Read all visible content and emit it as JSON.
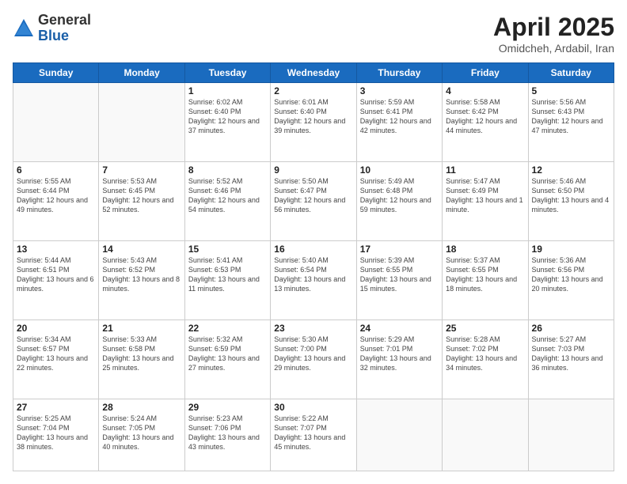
{
  "header": {
    "logo_general": "General",
    "logo_blue": "Blue",
    "month_year": "April 2025",
    "location": "Omidcheh, Ardabil, Iran"
  },
  "weekdays": [
    "Sunday",
    "Monday",
    "Tuesday",
    "Wednesday",
    "Thursday",
    "Friday",
    "Saturday"
  ],
  "weeks": [
    [
      {
        "day": "",
        "sunrise": "",
        "sunset": "",
        "daylight": ""
      },
      {
        "day": "",
        "sunrise": "",
        "sunset": "",
        "daylight": ""
      },
      {
        "day": "1",
        "sunrise": "Sunrise: 6:02 AM",
        "sunset": "Sunset: 6:40 PM",
        "daylight": "Daylight: 12 hours and 37 minutes."
      },
      {
        "day": "2",
        "sunrise": "Sunrise: 6:01 AM",
        "sunset": "Sunset: 6:40 PM",
        "daylight": "Daylight: 12 hours and 39 minutes."
      },
      {
        "day": "3",
        "sunrise": "Sunrise: 5:59 AM",
        "sunset": "Sunset: 6:41 PM",
        "daylight": "Daylight: 12 hours and 42 minutes."
      },
      {
        "day": "4",
        "sunrise": "Sunrise: 5:58 AM",
        "sunset": "Sunset: 6:42 PM",
        "daylight": "Daylight: 12 hours and 44 minutes."
      },
      {
        "day": "5",
        "sunrise": "Sunrise: 5:56 AM",
        "sunset": "Sunset: 6:43 PM",
        "daylight": "Daylight: 12 hours and 47 minutes."
      }
    ],
    [
      {
        "day": "6",
        "sunrise": "Sunrise: 5:55 AM",
        "sunset": "Sunset: 6:44 PM",
        "daylight": "Daylight: 12 hours and 49 minutes."
      },
      {
        "day": "7",
        "sunrise": "Sunrise: 5:53 AM",
        "sunset": "Sunset: 6:45 PM",
        "daylight": "Daylight: 12 hours and 52 minutes."
      },
      {
        "day": "8",
        "sunrise": "Sunrise: 5:52 AM",
        "sunset": "Sunset: 6:46 PM",
        "daylight": "Daylight: 12 hours and 54 minutes."
      },
      {
        "day": "9",
        "sunrise": "Sunrise: 5:50 AM",
        "sunset": "Sunset: 6:47 PM",
        "daylight": "Daylight: 12 hours and 56 minutes."
      },
      {
        "day": "10",
        "sunrise": "Sunrise: 5:49 AM",
        "sunset": "Sunset: 6:48 PM",
        "daylight": "Daylight: 12 hours and 59 minutes."
      },
      {
        "day": "11",
        "sunrise": "Sunrise: 5:47 AM",
        "sunset": "Sunset: 6:49 PM",
        "daylight": "Daylight: 13 hours and 1 minute."
      },
      {
        "day": "12",
        "sunrise": "Sunrise: 5:46 AM",
        "sunset": "Sunset: 6:50 PM",
        "daylight": "Daylight: 13 hours and 4 minutes."
      }
    ],
    [
      {
        "day": "13",
        "sunrise": "Sunrise: 5:44 AM",
        "sunset": "Sunset: 6:51 PM",
        "daylight": "Daylight: 13 hours and 6 minutes."
      },
      {
        "day": "14",
        "sunrise": "Sunrise: 5:43 AM",
        "sunset": "Sunset: 6:52 PM",
        "daylight": "Daylight: 13 hours and 8 minutes."
      },
      {
        "day": "15",
        "sunrise": "Sunrise: 5:41 AM",
        "sunset": "Sunset: 6:53 PM",
        "daylight": "Daylight: 13 hours and 11 minutes."
      },
      {
        "day": "16",
        "sunrise": "Sunrise: 5:40 AM",
        "sunset": "Sunset: 6:54 PM",
        "daylight": "Daylight: 13 hours and 13 minutes."
      },
      {
        "day": "17",
        "sunrise": "Sunrise: 5:39 AM",
        "sunset": "Sunset: 6:55 PM",
        "daylight": "Daylight: 13 hours and 15 minutes."
      },
      {
        "day": "18",
        "sunrise": "Sunrise: 5:37 AM",
        "sunset": "Sunset: 6:55 PM",
        "daylight": "Daylight: 13 hours and 18 minutes."
      },
      {
        "day": "19",
        "sunrise": "Sunrise: 5:36 AM",
        "sunset": "Sunset: 6:56 PM",
        "daylight": "Daylight: 13 hours and 20 minutes."
      }
    ],
    [
      {
        "day": "20",
        "sunrise": "Sunrise: 5:34 AM",
        "sunset": "Sunset: 6:57 PM",
        "daylight": "Daylight: 13 hours and 22 minutes."
      },
      {
        "day": "21",
        "sunrise": "Sunrise: 5:33 AM",
        "sunset": "Sunset: 6:58 PM",
        "daylight": "Daylight: 13 hours and 25 minutes."
      },
      {
        "day": "22",
        "sunrise": "Sunrise: 5:32 AM",
        "sunset": "Sunset: 6:59 PM",
        "daylight": "Daylight: 13 hours and 27 minutes."
      },
      {
        "day": "23",
        "sunrise": "Sunrise: 5:30 AM",
        "sunset": "Sunset: 7:00 PM",
        "daylight": "Daylight: 13 hours and 29 minutes."
      },
      {
        "day": "24",
        "sunrise": "Sunrise: 5:29 AM",
        "sunset": "Sunset: 7:01 PM",
        "daylight": "Daylight: 13 hours and 32 minutes."
      },
      {
        "day": "25",
        "sunrise": "Sunrise: 5:28 AM",
        "sunset": "Sunset: 7:02 PM",
        "daylight": "Daylight: 13 hours and 34 minutes."
      },
      {
        "day": "26",
        "sunrise": "Sunrise: 5:27 AM",
        "sunset": "Sunset: 7:03 PM",
        "daylight": "Daylight: 13 hours and 36 minutes."
      }
    ],
    [
      {
        "day": "27",
        "sunrise": "Sunrise: 5:25 AM",
        "sunset": "Sunset: 7:04 PM",
        "daylight": "Daylight: 13 hours and 38 minutes."
      },
      {
        "day": "28",
        "sunrise": "Sunrise: 5:24 AM",
        "sunset": "Sunset: 7:05 PM",
        "daylight": "Daylight: 13 hours and 40 minutes."
      },
      {
        "day": "29",
        "sunrise": "Sunrise: 5:23 AM",
        "sunset": "Sunset: 7:06 PM",
        "daylight": "Daylight: 13 hours and 43 minutes."
      },
      {
        "day": "30",
        "sunrise": "Sunrise: 5:22 AM",
        "sunset": "Sunset: 7:07 PM",
        "daylight": "Daylight: 13 hours and 45 minutes."
      },
      {
        "day": "",
        "sunrise": "",
        "sunset": "",
        "daylight": ""
      },
      {
        "day": "",
        "sunrise": "",
        "sunset": "",
        "daylight": ""
      },
      {
        "day": "",
        "sunrise": "",
        "sunset": "",
        "daylight": ""
      }
    ]
  ]
}
